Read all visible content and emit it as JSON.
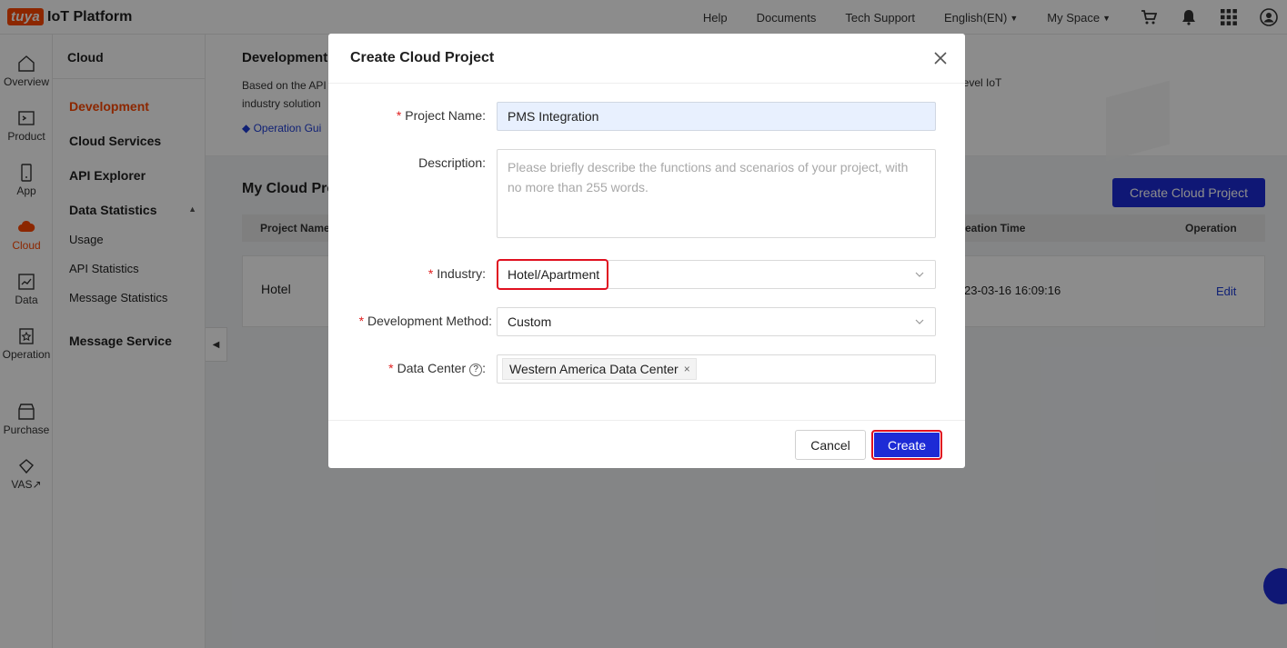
{
  "header": {
    "logo_badge": "tuya",
    "logo_text": "IoT Platform",
    "nav": [
      "Help",
      "Documents",
      "Tech Support"
    ],
    "language": "English(EN)",
    "space": "My Space"
  },
  "rail": {
    "items": [
      {
        "label": "Overview",
        "icon": "home-icon"
      },
      {
        "label": "Product",
        "icon": "terminal-icon"
      },
      {
        "label": "App",
        "icon": "phone-icon"
      },
      {
        "label": "Cloud",
        "icon": "cloud-icon"
      },
      {
        "label": "Data",
        "icon": "chart-icon"
      },
      {
        "label": "Operation",
        "icon": "star-badge-icon"
      },
      {
        "label": "Purchase",
        "icon": "store-icon"
      },
      {
        "label": "VAS",
        "icon": "diamond-icon"
      }
    ],
    "vas_suffix": "↗"
  },
  "subnav": {
    "title": "Cloud",
    "items": [
      "Development",
      "Cloud Services",
      "API Explorer",
      "Data Statistics",
      "Usage",
      "API Statistics",
      "Message Statistics",
      "Message Service"
    ],
    "expand_caret": "▲",
    "collapse_caret": "◀"
  },
  "main": {
    "intro_title": "Development",
    "intro_desc_line1": "Based on the API",
    "intro_desc_line2": "industry solution",
    "intro_right": "level IoT",
    "guide_label": "Operation Gui",
    "list_title": "My Cloud Pro",
    "create_button": "Create Cloud Project",
    "table_headers": [
      "Project Name",
      "eation Time",
      "Operation"
    ],
    "rows": [
      {
        "name": "Hotel",
        "time": "23-03-16 16:09:16",
        "action": "Edit"
      }
    ]
  },
  "modal": {
    "title": "Create Cloud Project",
    "close_icon": "×",
    "fields": {
      "project_name_label": "Project Name",
      "project_name_value": "PMS Integration",
      "description_label": "Description",
      "description_placeholder": "Please briefly describe the functions and scenarios of your project, with no more than 255 words.",
      "industry_label": "Industry",
      "industry_value": "Hotel/Apartment",
      "dev_method_label": "Development Method",
      "dev_method_value": "Custom",
      "data_center_label": "Data Center",
      "data_center_tag": "Western America Data Center",
      "help_mark": "?",
      "tag_remove": "×"
    },
    "required_mark": "*",
    "colon": ":",
    "cancel_label": "Cancel",
    "create_label": "Create"
  },
  "colors": {
    "brand": "#ff4800",
    "primary": "#1d2bd6",
    "highlight": "#e01020"
  }
}
